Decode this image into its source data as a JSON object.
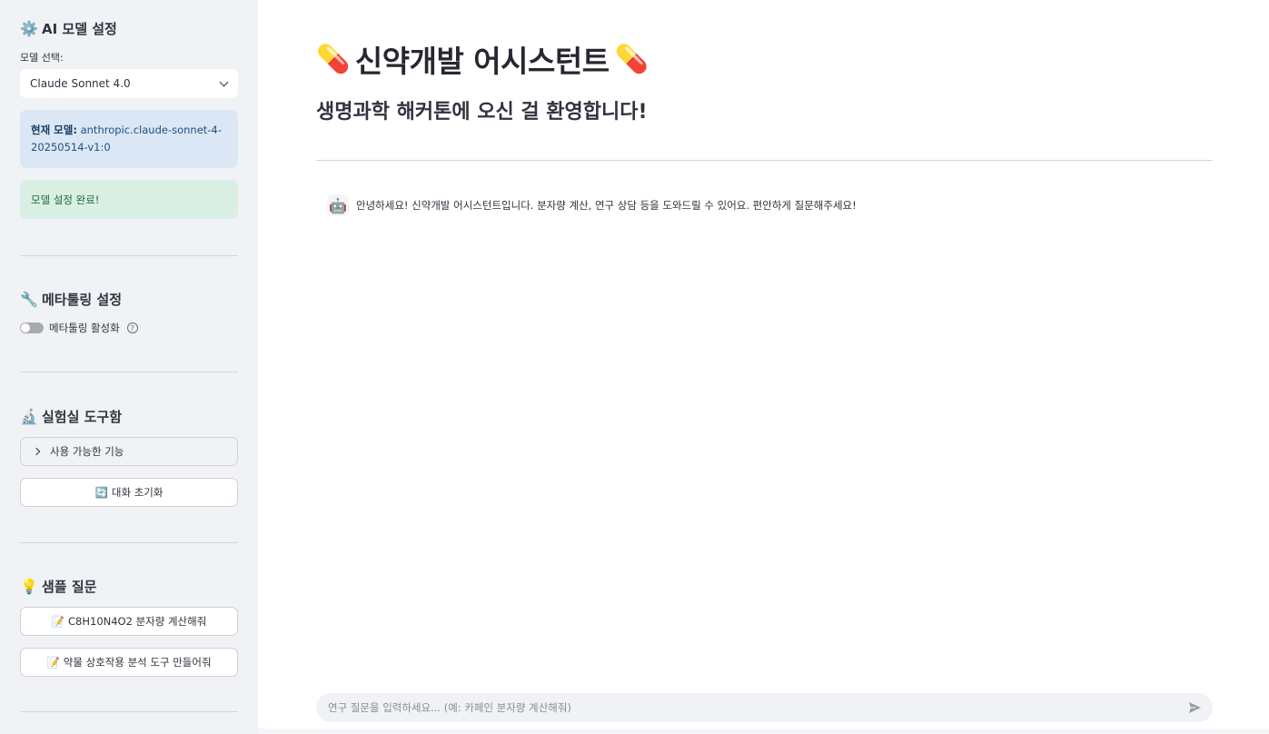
{
  "sidebar": {
    "model_section": {
      "icon": "gear-icon",
      "icon_glyph": "⚙️",
      "heading": "AI 모델 설정",
      "select_label": "모델 선택:",
      "select_value": "Claude Sonnet 4.0",
      "info_bold": "현재 모델:",
      "info_text": " anthropic.claude-sonnet-4-20250514-v1:0",
      "success_text": "모델 설정 완료!"
    },
    "metatool_section": {
      "icon": "wrench-icon",
      "icon_glyph": "🔧",
      "heading": "메타툴링 설정",
      "toggle_label": "메타툴링 활성화",
      "toggle_on": false,
      "help_glyph": "?"
    },
    "lab_section": {
      "icon": "microscope-icon",
      "icon_glyph": "🔬",
      "heading": "실험실 도구함",
      "expander_label": "사용 가능한 기능",
      "reset_icon_glyph": "🔄",
      "reset_label": "대화 초기화"
    },
    "sample_section": {
      "icon": "lightbulb-icon",
      "icon_glyph": "💡",
      "heading": "샘플 질문",
      "memo_glyph": "📝",
      "questions": [
        "C8H10N4O2 분자량 계산해줘",
        "약물 상호작용 분석 도구 만들어줘"
      ]
    }
  },
  "main": {
    "title_icon_glyph": "💊",
    "title": "신약개발 어시스턴트",
    "subtitle": "생명과학 해커톤에 오신 걸 환영합니다!",
    "messages": [
      {
        "avatar_glyph": "🤖",
        "text": "안녕하세요! 신약개발 어시스턴트입니다. 분자량 계산, 연구 상담 등을 도와드릴 수 있어요. 편안하게 질문해주세요!"
      }
    ],
    "chat_input_placeholder": "연구 질문을 입력하세요... (예: 카페인 분자량 계산해줘)"
  },
  "colors": {
    "sidebar_bg": "#f0f2f6",
    "info_bg": "#dbe7f4",
    "success_bg": "#d9efe3"
  }
}
